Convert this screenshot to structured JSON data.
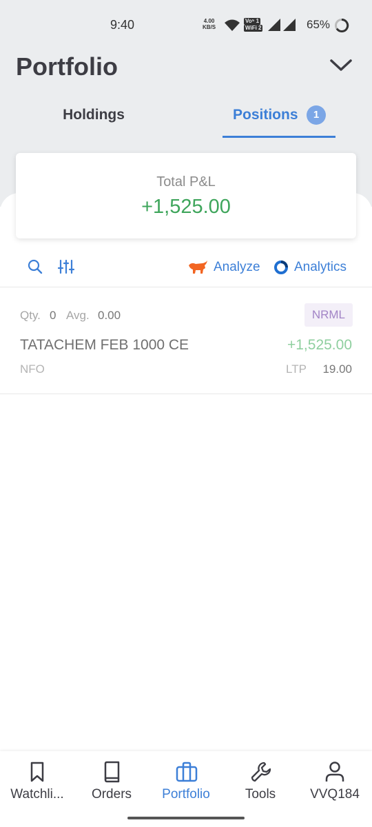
{
  "status_bar": {
    "time": "9:40",
    "net_speed_value": "4.00",
    "net_speed_unit": "KB/S",
    "volte": "Vo⁵ 1",
    "wifi_calling": "WiFi 2",
    "battery": "65%"
  },
  "header": {
    "title": "Portfolio",
    "dropdown_icon": "chevron-down-icon"
  },
  "tabs": [
    {
      "label": "Holdings",
      "active": false
    },
    {
      "label": "Positions",
      "active": true,
      "badge": "1"
    }
  ],
  "summary": {
    "label": "Total P&L",
    "value": "+1,525.00",
    "value_color": "#3ea55b"
  },
  "toolbar": {
    "search_icon": "search-icon",
    "filter_icon": "filter-sliders-icon",
    "analyze_label": "Analyze",
    "analytics_label": "Analytics"
  },
  "positions": [
    {
      "qty_label": "Qty.",
      "qty": "0",
      "avg_label": "Avg.",
      "avg": "0.00",
      "product": "NRML",
      "instrument": "TATACHEM FEB 1000 CE",
      "pnl": "+1,525.00",
      "exchange": "NFO",
      "ltp_label": "LTP",
      "ltp": "19.00"
    }
  ],
  "bottom_nav": [
    {
      "label": "Watchli...",
      "icon": "bookmark-icon",
      "active": false
    },
    {
      "label": "Orders",
      "icon": "book-icon",
      "active": false
    },
    {
      "label": "Portfolio",
      "icon": "briefcase-icon",
      "active": true
    },
    {
      "label": "Tools",
      "icon": "wrench-icon",
      "active": false
    },
    {
      "label": "VVQ184",
      "icon": "user-icon",
      "active": false
    }
  ],
  "colors": {
    "accent": "#3c7fd7",
    "profit": "#3ea55b",
    "analyze_brand": "#f26522"
  }
}
